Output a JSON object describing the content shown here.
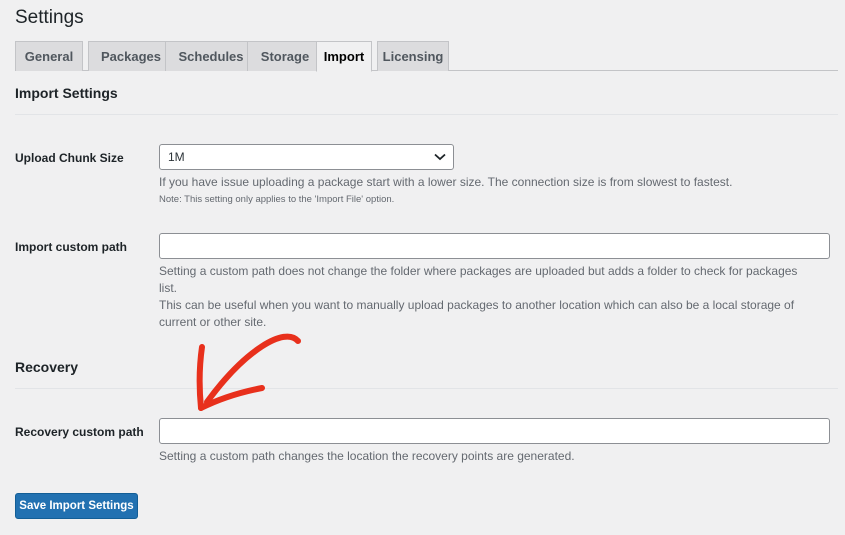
{
  "page": {
    "title": "Settings"
  },
  "tabs": [
    {
      "label": "General",
      "active": false
    },
    {
      "label": "Packages",
      "active": false
    },
    {
      "label": "Schedules",
      "active": false
    },
    {
      "label": "Storage",
      "active": false
    },
    {
      "label": "Import",
      "active": true
    },
    {
      "label": "Licensing",
      "active": false
    }
  ],
  "import_settings": {
    "title": "Import Settings",
    "upload_chunk": {
      "label": "Upload Chunk Size",
      "selected": "1M",
      "description": "If you have issue uploading a package start with a lower size. The connection size is from slowest to fastest.",
      "note": "Note: This setting only applies to the 'Import File' option."
    },
    "custom_path": {
      "label": "Import custom path",
      "value": "",
      "description_line1": "Setting a custom path does not change the folder where packages are uploaded but adds a folder to check for packages",
      "description_line2": "list.",
      "description_line3": "This can be useful when you want to manually upload packages to another location which can also be a local storage of",
      "description_line4": "current or other site."
    }
  },
  "recovery": {
    "title": "Recovery",
    "custom_path": {
      "label": "Recovery custom path",
      "value": "",
      "description": "Setting a custom path changes the location the recovery points are generated."
    }
  },
  "actions": {
    "save_label": "Save Import Settings"
  },
  "colors": {
    "accent": "#2271b1",
    "annotation": "#e8301c",
    "background": "#f0f0f1"
  }
}
